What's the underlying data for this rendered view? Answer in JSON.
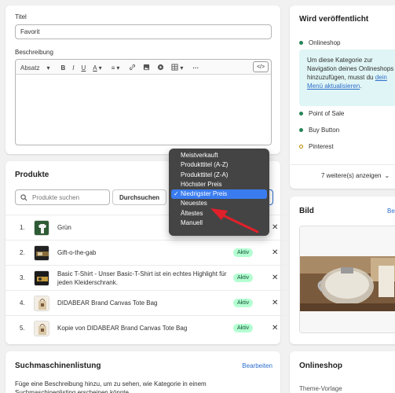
{
  "details": {
    "title_label": "Titel",
    "title_value": "Favorit",
    "description_label": "Beschreibung",
    "toolbar": {
      "paragraph": "Absatz",
      "bold": "B",
      "italic": "I",
      "underline": "U",
      "text_color": "A",
      "align": "≡",
      "more": "···",
      "code": "</>"
    }
  },
  "products": {
    "heading": "Produkte",
    "search_placeholder": "Produkte suchen",
    "browse_label": "Durchsuchen",
    "rows": [
      {
        "num": "1.",
        "title": "Grün",
        "badge": ""
      },
      {
        "num": "2.",
        "title": "Gift-o-the-gab",
        "badge": "Aktiv"
      },
      {
        "num": "3.",
        "title": "Basic T-Shirt - Unser Basic-T-Shirt ist ein echtes Highlight für jeden Kleiderschrank.",
        "badge": "Aktiv"
      },
      {
        "num": "4.",
        "title": "DIDABEAR Brand Canvas Tote Bag",
        "badge": "Aktiv"
      },
      {
        "num": "5.",
        "title": "Kopie von DIDABEAR Brand Canvas Tote Bag",
        "badge": "Aktiv"
      }
    ],
    "close_glyph": "✕"
  },
  "sort_menu": {
    "items": [
      "Meistverkauft",
      "Produkttitel (A-Z)",
      "Produkttitel (Z-A)",
      "Höchster Preis",
      "Niedrigster Preis",
      "Neuestes",
      "Ältestes",
      "Manuell"
    ],
    "selected_index": 4,
    "check": "✓"
  },
  "seo": {
    "heading": "Suchmaschinenlistung",
    "edit_label": "Bearbeiten",
    "text": "Füge eine Beschreibung hinzu, um zu sehen, wie Kategorie in einem Suchmaschinenlisting erscheinen könnte."
  },
  "publishing": {
    "heading": "Wird veröffentlicht",
    "onlineshop": "Onlineshop",
    "info_text": "Um diese Kategorie zur Navigation deines Onlineshops hinzuzufügen, musst du ",
    "info_link": "dein Menü aktualisieren",
    "info_end": ".",
    "channels": [
      {
        "name": "Point of Sale",
        "color": "#29845a",
        "hollow": false
      },
      {
        "name": "Buy Button",
        "color": "#29845a",
        "hollow": false
      },
      {
        "name": "Pinterest",
        "color": "#b98900",
        "hollow": true
      }
    ],
    "more_label": "7 weitere(s) anzeigen",
    "more_chevron": "⌄"
  },
  "image_card": {
    "heading": "Bild",
    "edit_label": "Be"
  },
  "onlineshop_card": {
    "heading": "Onlineshop",
    "theme_label": "Theme-Vorlage"
  },
  "colors": {
    "accent": "#2c6ecb",
    "success": "#29845a",
    "badge_bg": "#b4fed2",
    "menu_bg": "#444444",
    "menu_selected": "#3a7cf0",
    "arrow": "#e0202a"
  }
}
